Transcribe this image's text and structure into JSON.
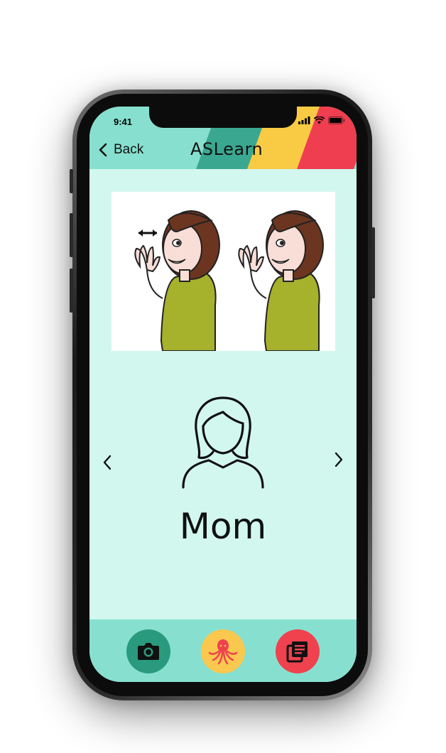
{
  "status_bar": {
    "time": "9:41"
  },
  "header": {
    "back_label": "Back",
    "app_title": "ASLearn",
    "stripe_colors": [
      "#3aa890",
      "#f9cb45",
      "#ef3e4f"
    ]
  },
  "card": {
    "word": "Mom",
    "icon": "woman-outline-icon",
    "illustration": "asl-sign-mom-illustration"
  },
  "tabbar": {
    "items": [
      {
        "icon": "camera-icon",
        "color": "#2a9a7e"
      },
      {
        "icon": "octopus-icon",
        "color": "#fac84f"
      },
      {
        "icon": "book-icon",
        "color": "#f0414f"
      }
    ]
  },
  "colors": {
    "header_bg": "#87e0cf",
    "screen_bg": "#d2f7ef"
  }
}
